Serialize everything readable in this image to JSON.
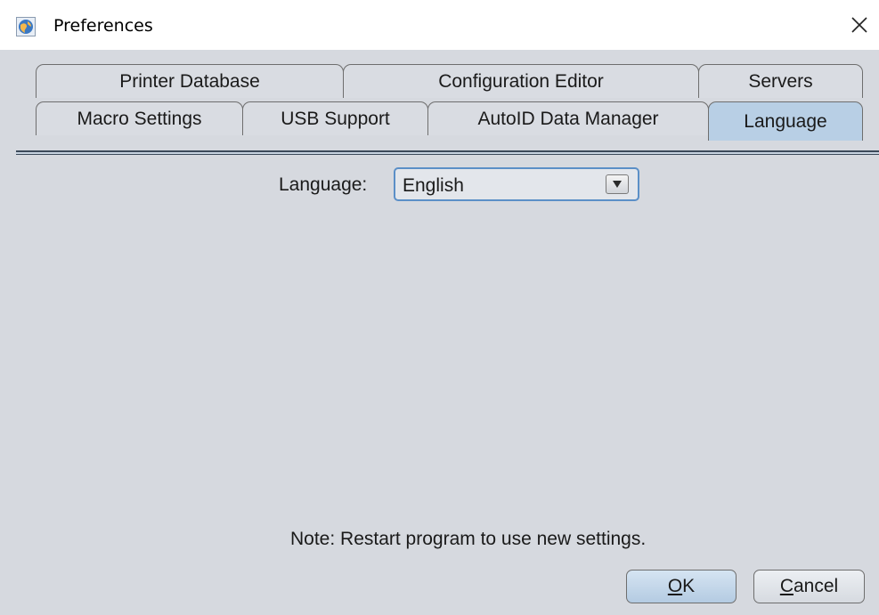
{
  "window": {
    "title": "Preferences",
    "icon": "app-globe-icon",
    "close_symbol": "✕"
  },
  "tabs": {
    "row1": [
      {
        "label": "Printer Database"
      },
      {
        "label": "Configuration Editor"
      },
      {
        "label": "Servers"
      }
    ],
    "row2": [
      {
        "label": "Macro Settings"
      },
      {
        "label": "USB Support"
      },
      {
        "label": "AutoID Data Manager"
      },
      {
        "label": "Language",
        "selected": true
      }
    ]
  },
  "language": {
    "label": "Language:",
    "selected": "English"
  },
  "note": "Note: Restart program to use new settings.",
  "buttons": {
    "ok": {
      "mnemonic": "O",
      "rest": "K"
    },
    "cancel": {
      "mnemonic": "C",
      "rest": "ancel"
    }
  },
  "colors": {
    "panel": "#d6d9df",
    "selected_tab": "#b8cfe5",
    "focus_border": "#5b8fc7"
  }
}
